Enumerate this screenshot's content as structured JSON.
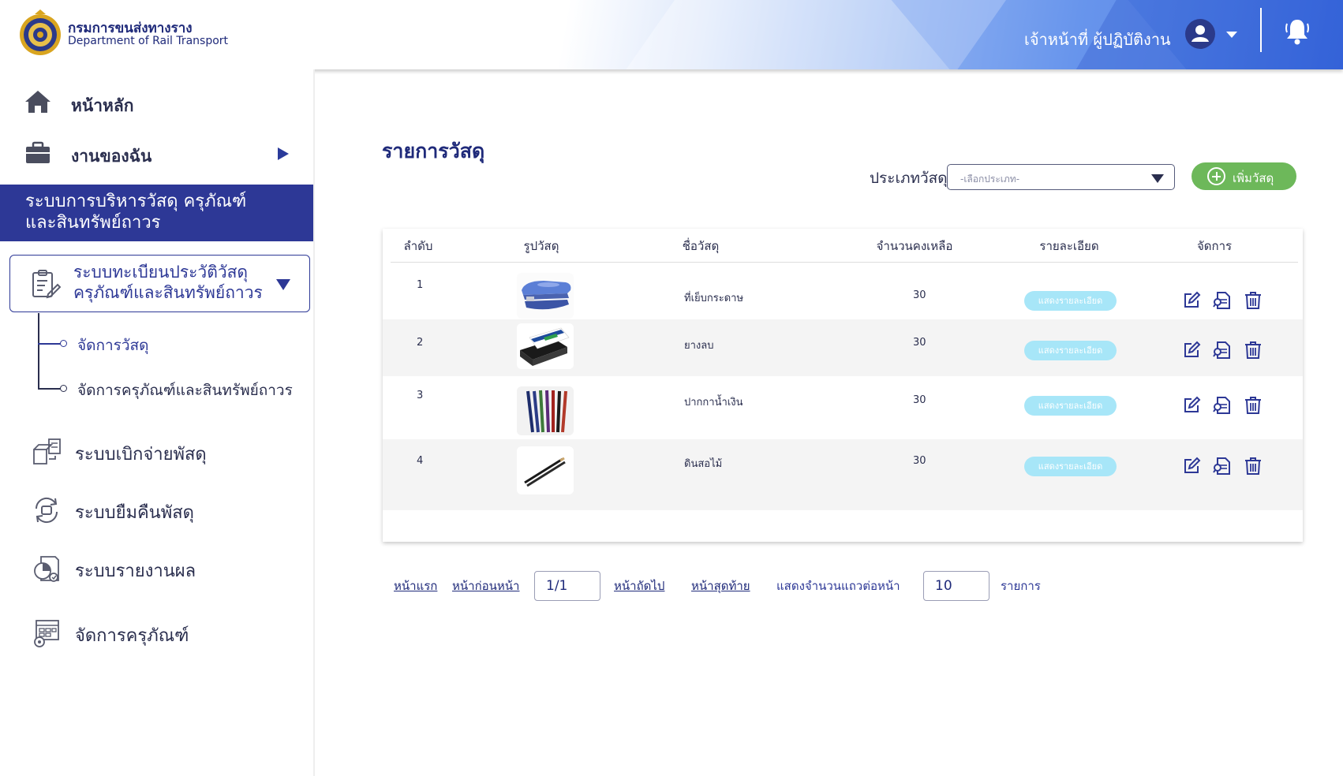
{
  "header": {
    "org_name_th": "กรมการขนส่งทางราง",
    "org_name_en": "Department of Rail Transport",
    "user_role": "เจ้าหน้าที่ ผู้ปฏิบัติงาน"
  },
  "sidebar": {
    "home_label": "หน้าหลัก",
    "my_work_label": "งานของฉัน",
    "system_banner_line1": "ระบบการบริหารวัสดุ ครุภัณฑ์",
    "system_banner_line2": "และสินทรัพย์ถาวร",
    "registry_line1": "ระบบทะเบียนประวัติวัสดุ",
    "registry_line2": "ครุภัณฑ์และสินทรัพย์ถาวร",
    "submenu": [
      "จัดการวัสดุ",
      "จัดการครุภัณฑ์และสินทรัพย์ถาวร"
    ],
    "systems": [
      {
        "label": "ระบบเบิกจ่ายพัสดุ",
        "icon": "disbursement-icon"
      },
      {
        "label": "ระบบยืมคืนพัสดุ",
        "icon": "borrow-return-icon"
      },
      {
        "label": "ระบบรายงานผล",
        "icon": "report-icon"
      },
      {
        "label": "จัดการครุภัณฑ์",
        "icon": "equipment-settings-icon"
      }
    ]
  },
  "main": {
    "title": "รายการวัสดุ",
    "type_label": "ประเภทวัสดุ",
    "type_placeholder": "-เลือกประเภท-",
    "add_button": "เพิ่มวัสดุ",
    "columns": [
      "ลำดับ",
      "รูปวัสดุ",
      "ชื่อวัสดุ",
      "จำนวนคงเหลือ",
      "รายละเอียด",
      "จัดการ"
    ],
    "rows": [
      {
        "no": "1",
        "name": "ที่เย็บกระดาษ",
        "qty": "30",
        "detail": "แสดงรายละเอียด",
        "image": "stapler"
      },
      {
        "no": "2",
        "name": "ยางลบ",
        "qty": "30",
        "detail": "แสดงรายละเอียด",
        "image": "eraser"
      },
      {
        "no": "3",
        "name": "ปากกาน้ำเงิน",
        "qty": "30",
        "detail": "แสดงรายละเอียด",
        "image": "pens"
      },
      {
        "no": "4",
        "name": "ดินสอไม้",
        "qty": "30",
        "detail": "แสดงรายละเอียด",
        "image": "pencils"
      }
    ]
  },
  "pagination": {
    "first": "หน้าแรก",
    "prev": "หน้าก่อนหน้า",
    "page_value": "1/1",
    "next": "หน้าถัดไป",
    "last": "หน้าสุดท้าย",
    "rows_per_page_label": "แสดงจำนวนแถวต่อหน้า",
    "rows_per_page_value": "10",
    "items_label": "รายการ"
  },
  "colors": {
    "brand_navy": "#2d3896",
    "add_green": "#6db85a",
    "detail_cyan": "#a7e6f8"
  }
}
